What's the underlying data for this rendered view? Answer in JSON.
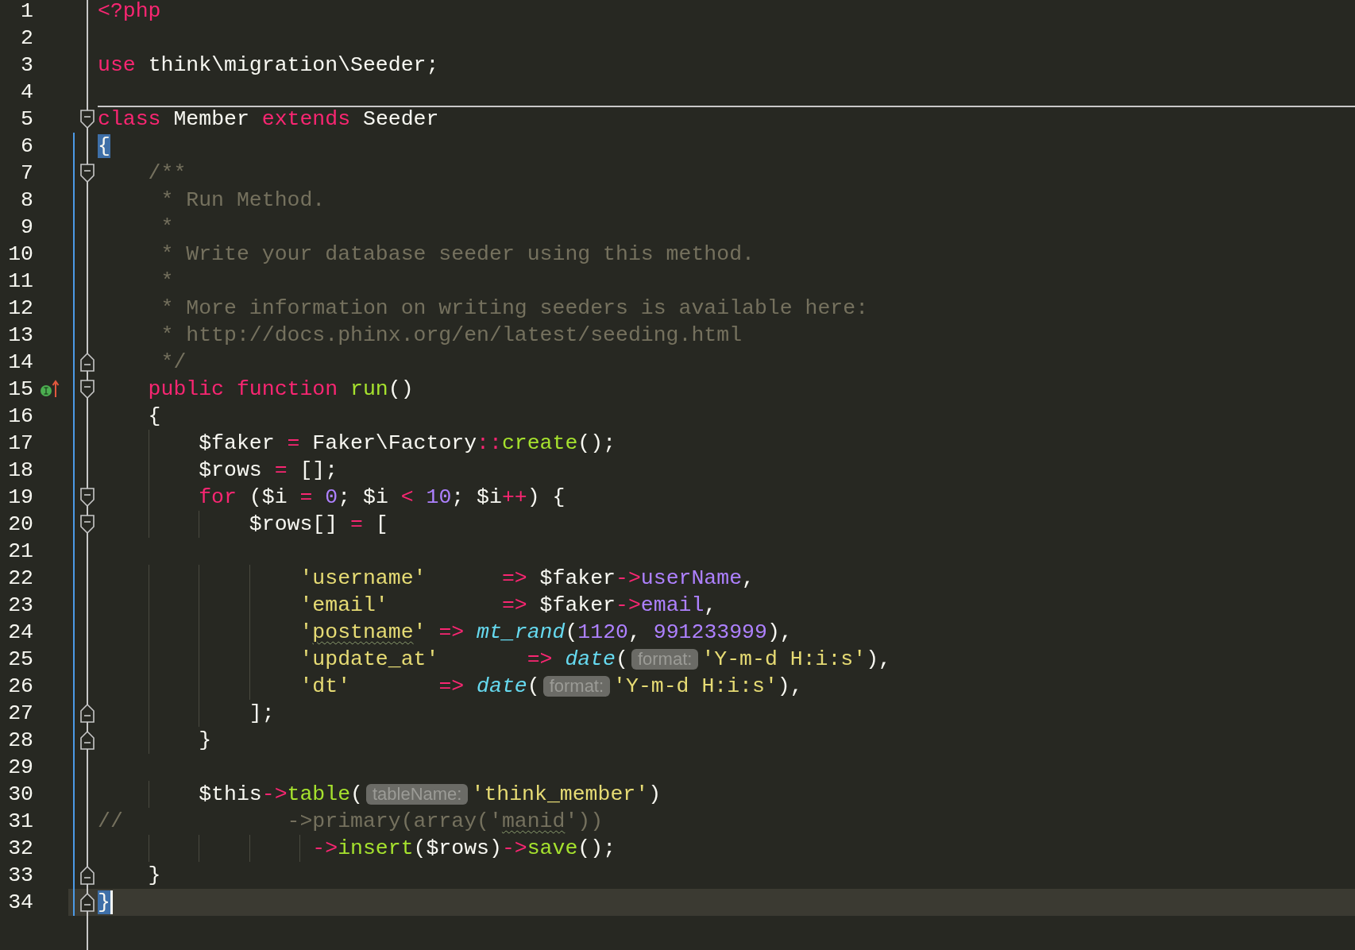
{
  "editor": {
    "lines": [
      {
        "number": "1",
        "modified": false,
        "current": false,
        "tokens": [
          {
            "text": "<?php",
            "kind": "keyword"
          }
        ]
      },
      {
        "number": "2",
        "modified": false,
        "current": false
      },
      {
        "number": "3",
        "modified": false,
        "current": false,
        "tokens": [
          {
            "text": "use ",
            "kind": "keyword"
          },
          {
            "text": "think\\migration\\Seeder;",
            "kind": "plain"
          }
        ]
      },
      {
        "number": "4",
        "modified": false,
        "current": false
      },
      {
        "number": "5",
        "modified": false,
        "current": false,
        "separator": true,
        "fold_start": true,
        "tokens": [
          {
            "text": "class",
            "kind": "keyword"
          },
          {
            "text": " Member ",
            "kind": "plain"
          },
          {
            "text": "extends",
            "kind": "keyword"
          },
          {
            "text": " Seeder",
            "kind": "plain"
          }
        ]
      },
      {
        "number": "6",
        "modified": true,
        "current": false,
        "tokens": [
          {
            "text": "{",
            "kind": "plain",
            "matched": true
          }
        ]
      },
      {
        "number": "7",
        "modified": true,
        "current": false,
        "fold_start": true,
        "tokens": [
          {
            "text": "    /**",
            "kind": "comment"
          }
        ]
      },
      {
        "number": "8",
        "modified": true,
        "current": false,
        "tokens": [
          {
            "text": "     * Run Method.",
            "kind": "comment"
          }
        ]
      },
      {
        "number": "9",
        "modified": true,
        "current": false,
        "tokens": [
          {
            "text": "     *",
            "kind": "comment"
          }
        ]
      },
      {
        "number": "10",
        "modified": true,
        "current": false,
        "tokens": [
          {
            "text": "     * Write your database seeder using this method.",
            "kind": "comment"
          }
        ]
      },
      {
        "number": "11",
        "modified": true,
        "current": false,
        "tokens": [
          {
            "text": "     *",
            "kind": "comment"
          }
        ]
      },
      {
        "number": "12",
        "modified": true,
        "current": false,
        "tokens": [
          {
            "text": "     * More information on writing seeders is available here:",
            "kind": "comment"
          }
        ]
      },
      {
        "number": "13",
        "modified": true,
        "current": false,
        "tokens": [
          {
            "text": "     * http://docs.phinx.org/en/latest/seeding.html",
            "kind": "comment"
          }
        ]
      },
      {
        "number": "14",
        "modified": true,
        "current": false,
        "fold_end": true,
        "tokens": [
          {
            "text": "     */",
            "kind": "comment"
          }
        ]
      },
      {
        "number": "15",
        "modified": true,
        "current": false,
        "fold_start": true,
        "implements_marker": true,
        "tokens": [
          {
            "text": "    public function ",
            "kind": "keyword"
          },
          {
            "text": "run",
            "kind": "function"
          },
          {
            "text": "()",
            "kind": "plain"
          }
        ]
      },
      {
        "number": "16",
        "modified": true,
        "current": false,
        "tokens": [
          {
            "text": "    {",
            "kind": "plain"
          }
        ]
      },
      {
        "number": "17",
        "modified": true,
        "current": false,
        "tokens": [
          {
            "text": "        $faker ",
            "kind": "plain"
          },
          {
            "text": "=",
            "kind": "operator"
          },
          {
            "text": " Faker\\Factory",
            "kind": "plain"
          },
          {
            "text": "::",
            "kind": "operator"
          },
          {
            "text": "create",
            "kind": "function"
          },
          {
            "text": "();",
            "kind": "plain"
          }
        ]
      },
      {
        "number": "18",
        "modified": true,
        "current": false,
        "tokens": [
          {
            "text": "        $rows ",
            "kind": "plain"
          },
          {
            "text": "=",
            "kind": "operator"
          },
          {
            "text": " [];",
            "kind": "plain"
          }
        ]
      },
      {
        "number": "19",
        "modified": true,
        "current": false,
        "fold_start": true,
        "tokens": [
          {
            "text": "        for",
            "kind": "keyword"
          },
          {
            "text": " ($i ",
            "kind": "plain"
          },
          {
            "text": "= ",
            "kind": "operator"
          },
          {
            "text": "0",
            "kind": "number"
          },
          {
            "text": "; $i ",
            "kind": "plain"
          },
          {
            "text": "< ",
            "kind": "operator"
          },
          {
            "text": "10",
            "kind": "number"
          },
          {
            "text": "; $i",
            "kind": "plain"
          },
          {
            "text": "++",
            "kind": "operator"
          },
          {
            "text": ") {",
            "kind": "plain"
          }
        ]
      },
      {
        "number": "20",
        "modified": true,
        "current": false,
        "fold_start": true,
        "tokens": [
          {
            "text": "            $rows[] ",
            "kind": "plain"
          },
          {
            "text": "=",
            "kind": "operator"
          },
          {
            "text": " [",
            "kind": "plain"
          }
        ]
      },
      {
        "number": "21",
        "modified": true,
        "current": false
      },
      {
        "number": "22",
        "modified": true,
        "current": false,
        "tokens": [
          {
            "text": "                'username'      ",
            "kind": "string"
          },
          {
            "text": "=>",
            "kind": "operator"
          },
          {
            "text": " $faker",
            "kind": "plain"
          },
          {
            "text": "->",
            "kind": "operator"
          },
          {
            "text": "userName",
            "kind": "property"
          },
          {
            "text": ",",
            "kind": "plain"
          }
        ]
      },
      {
        "number": "23",
        "modified": true,
        "current": false,
        "tokens": [
          {
            "text": "                'email'         ",
            "kind": "string"
          },
          {
            "text": "=>",
            "kind": "operator"
          },
          {
            "text": " $faker",
            "kind": "plain"
          },
          {
            "text": "->",
            "kind": "operator"
          },
          {
            "text": "email",
            "kind": "property"
          },
          {
            "text": ",",
            "kind": "plain"
          }
        ]
      },
      {
        "number": "24",
        "modified": true,
        "current": false,
        "tokens": [
          {
            "text": "                '",
            "kind": "string"
          },
          {
            "text": "postname",
            "kind": "string",
            "misspelled": true
          },
          {
            "text": "' ",
            "kind": "string"
          },
          {
            "text": "=> ",
            "kind": "operator"
          },
          {
            "text": "mt_rand",
            "kind": "builtin"
          },
          {
            "text": "(",
            "kind": "plain"
          },
          {
            "text": "1120",
            "kind": "number"
          },
          {
            "text": ", ",
            "kind": "plain"
          },
          {
            "text": "991233999",
            "kind": "number"
          },
          {
            "text": "),",
            "kind": "plain"
          }
        ]
      },
      {
        "number": "25",
        "modified": true,
        "current": false,
        "tokens": [
          {
            "text": "                'update_at'       ",
            "kind": "string"
          },
          {
            "text": "=> ",
            "kind": "operator"
          },
          {
            "text": "date",
            "kind": "builtin"
          },
          {
            "text": "(",
            "kind": "plain"
          },
          {
            "text": "format:",
            "kind": "hint"
          },
          {
            "text": "'Y-m-d H:i:s'",
            "kind": "string"
          },
          {
            "text": "),",
            "kind": "plain"
          }
        ]
      },
      {
        "number": "26",
        "modified": true,
        "current": false,
        "tokens": [
          {
            "text": "                'dt'       ",
            "kind": "string"
          },
          {
            "text": "=> ",
            "kind": "operator"
          },
          {
            "text": "date",
            "kind": "builtin"
          },
          {
            "text": "(",
            "kind": "plain"
          },
          {
            "text": "format:",
            "kind": "hint"
          },
          {
            "text": "'Y-m-d H:i:s'",
            "kind": "string"
          },
          {
            "text": "),",
            "kind": "plain"
          }
        ]
      },
      {
        "number": "27",
        "modified": true,
        "current": false,
        "fold_end": true,
        "tokens": [
          {
            "text": "            ];",
            "kind": "plain"
          }
        ]
      },
      {
        "number": "28",
        "modified": true,
        "current": false,
        "fold_end": true,
        "tokens": [
          {
            "text": "        }",
            "kind": "plain"
          }
        ]
      },
      {
        "number": "29",
        "modified": true,
        "current": false
      },
      {
        "number": "30",
        "modified": true,
        "current": false,
        "tokens": [
          {
            "text": "        $this",
            "kind": "plain"
          },
          {
            "text": "->",
            "kind": "operator"
          },
          {
            "text": "table",
            "kind": "function"
          },
          {
            "text": "(",
            "kind": "plain"
          },
          {
            "text": "tableName:",
            "kind": "hint"
          },
          {
            "text": "'think_member'",
            "kind": "string"
          },
          {
            "text": ")",
            "kind": "plain"
          }
        ]
      },
      {
        "number": "31",
        "modified": true,
        "current": false,
        "tokens": [
          {
            "text": "//             ->primary(array('",
            "kind": "comment"
          },
          {
            "text": "manid",
            "kind": "comment",
            "misspelled": true
          },
          {
            "text": "'))",
            "kind": "comment"
          }
        ]
      },
      {
        "number": "32",
        "modified": true,
        "current": false,
        "tokens": [
          {
            "text": "                 ->",
            "kind": "operator"
          },
          {
            "text": "insert",
            "kind": "function"
          },
          {
            "text": "($rows)",
            "kind": "plain"
          },
          {
            "text": "->",
            "kind": "operator"
          },
          {
            "text": "save",
            "kind": "function"
          },
          {
            "text": "();",
            "kind": "plain"
          }
        ]
      },
      {
        "number": "33",
        "modified": true,
        "current": false,
        "fold_end": true,
        "tokens": [
          {
            "text": "    }",
            "kind": "plain"
          }
        ]
      },
      {
        "number": "34",
        "modified": true,
        "current": true,
        "fold_end": true,
        "tokens": [
          {
            "text": "}",
            "kind": "plain",
            "matched": true
          }
        ]
      }
    ]
  }
}
